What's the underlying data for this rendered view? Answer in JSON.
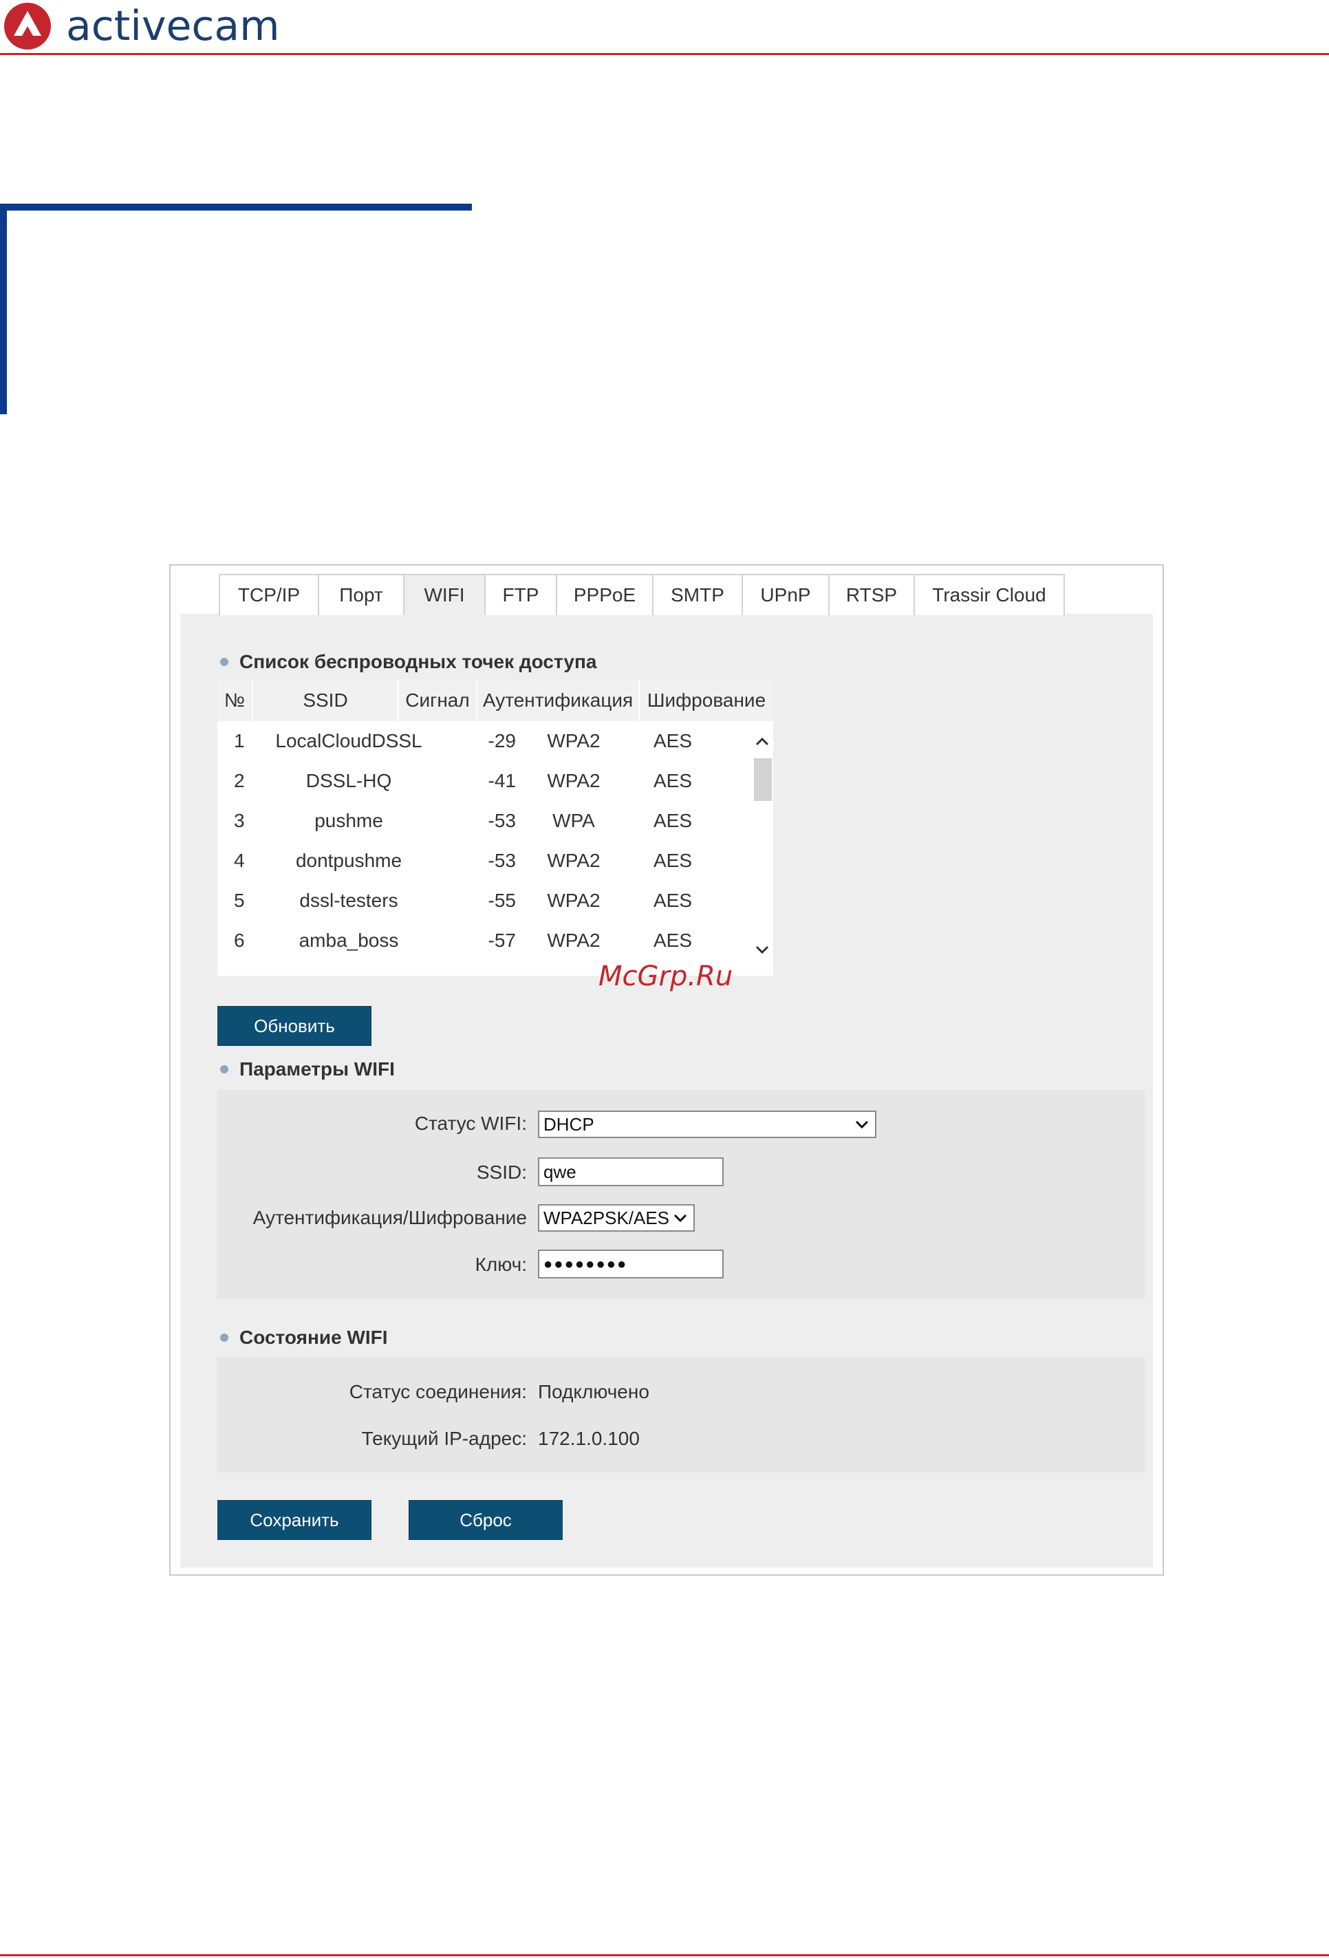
{
  "brand": {
    "name": "activecam",
    "accent": "#c4262e",
    "text_color": "#1c3e6e",
    "bracket_color": "#0c3a8c"
  },
  "tabs": [
    {
      "label": "TCP/IP"
    },
    {
      "label": "Порт"
    },
    {
      "label": "WIFI",
      "active": true
    },
    {
      "label": "FTP"
    },
    {
      "label": "PPPoE"
    },
    {
      "label": "SMTP"
    },
    {
      "label": "UPnP"
    },
    {
      "label": "RTSP"
    },
    {
      "label": "Trassir Cloud"
    }
  ],
  "ap_list": {
    "title": "Список беспроводных точек доступа",
    "columns": [
      "№",
      "SSID",
      "Сигнал",
      "Аутентификация",
      "Шифрование"
    ],
    "rows": [
      {
        "no": "1",
        "ssid": "LocalCloudDSSL",
        "signal": "-29",
        "auth": "WPA2",
        "enc": "AES"
      },
      {
        "no": "2",
        "ssid": "DSSL-HQ",
        "signal": "-41",
        "auth": "WPA2",
        "enc": "AES"
      },
      {
        "no": "3",
        "ssid": "pushme",
        "signal": "-53",
        "auth": "WPA",
        "enc": "AES"
      },
      {
        "no": "4",
        "ssid": "dontpushme",
        "signal": "-53",
        "auth": "WPA2",
        "enc": "AES"
      },
      {
        "no": "5",
        "ssid": "dssl-testers",
        "signal": "-55",
        "auth": "WPA2",
        "enc": "AES"
      },
      {
        "no": "6",
        "ssid": "amba_boss",
        "signal": "-57",
        "auth": "WPA2",
        "enc": "AES"
      }
    ],
    "refresh_label": "Обновить"
  },
  "wifi_params": {
    "title": "Параметры WIFI",
    "status_label": "Статус WIFI:",
    "status_value": "DHCP",
    "ssid_label": "SSID:",
    "ssid_value": "qwe",
    "auth_label": "Аутентификация/Шифрование",
    "auth_value": "WPA2PSK/AES",
    "key_label": "Ключ:",
    "key_value": "●●●●●●●●"
  },
  "wifi_state": {
    "title": "Состояние WIFI",
    "conn_label": "Статус соединения:",
    "conn_value": "Подключено",
    "ip_label": "Текущий IP-адрес:",
    "ip_value": "172.1.0.100"
  },
  "actions": {
    "save_label": "Сохранить",
    "reset_label": "Сброс"
  },
  "watermark": "McGrp.Ru"
}
